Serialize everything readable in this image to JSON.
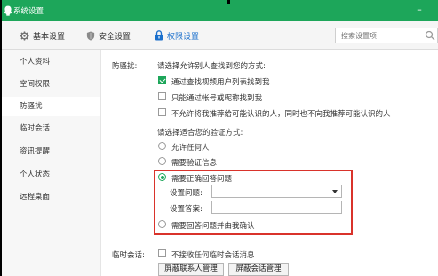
{
  "window": {
    "title": "系统设置",
    "minimize_glyph": "–",
    "accent": "#1da65a"
  },
  "toolbar": {
    "tabs": [
      {
        "label": "基本设置",
        "icon": "gear-icon"
      },
      {
        "label": "安全设置",
        "icon": "shield-icon"
      },
      {
        "label": "权限设置",
        "icon": "lock-icon",
        "active": true
      }
    ],
    "search_placeholder": "搜索设置项"
  },
  "sidebar": {
    "items": [
      {
        "label": "个人资料"
      },
      {
        "label": "空间权限"
      },
      {
        "label": "防骚扰",
        "active": true
      },
      {
        "label": "临时会话"
      },
      {
        "label": "资讯提醒"
      },
      {
        "label": "个人状态"
      },
      {
        "label": "远程桌面"
      }
    ]
  },
  "antiharass": {
    "label": "防骚扰:",
    "find_prompt": "请选择允许别人查找到您的方式:",
    "find_options": [
      {
        "label": "通过查找视频用户列表找到我",
        "checked": true
      },
      {
        "label": "只能通过帐号或昵称找到我",
        "checked": false
      },
      {
        "label": "不允许将我推荐给可能认识的人，同时也不向我推荐可能认识的人",
        "checked": false
      }
    ],
    "verify_prompt": "请选择适合您的验证方式:",
    "verify_options": [
      {
        "label": "允许任何人",
        "selected": false
      },
      {
        "label": "需要验证信息",
        "selected": false
      },
      {
        "label": "需要正确回答问题",
        "selected": true
      },
      {
        "label": "需要回答问题并由我确认",
        "selected": false
      }
    ],
    "question_label": "设置问题:",
    "question_value": "",
    "answer_label": "设置答案:",
    "answer_value": ""
  },
  "temp_session": {
    "label": "临时会话:",
    "option": {
      "label": "不接收任何临时会话消息",
      "checked": false
    },
    "buttons": [
      "屏蔽联系人管理",
      "屏蔽会话管理"
    ]
  }
}
